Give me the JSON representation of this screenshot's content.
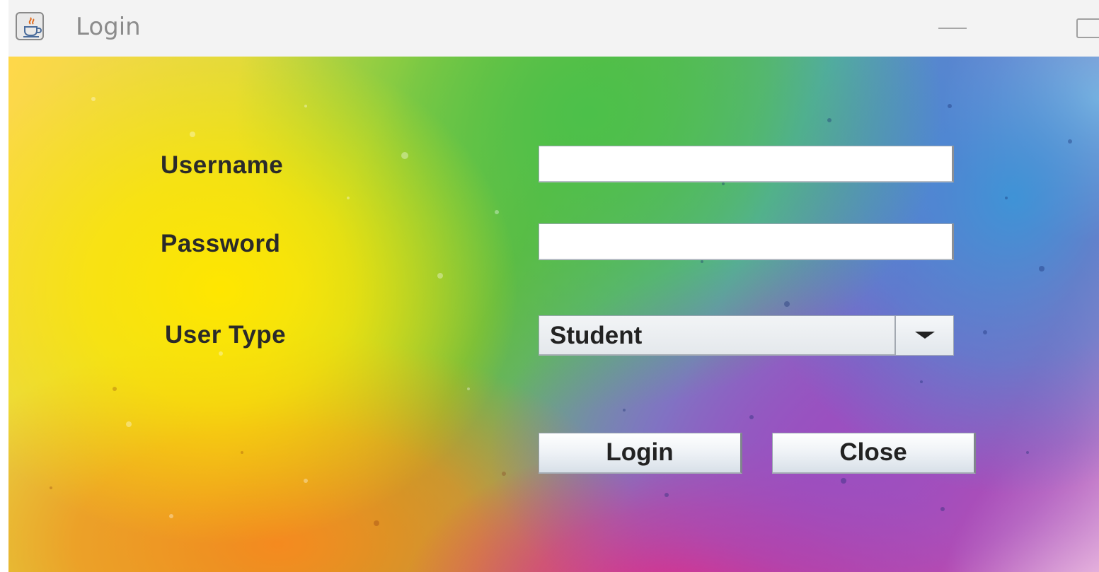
{
  "window": {
    "title": "Login",
    "icon": "java-cup-icon",
    "controls": {
      "minimize": "minimize-icon",
      "maximize": "maximize-icon"
    }
  },
  "form": {
    "username_label": "Username",
    "username_value": "",
    "password_label": "Password",
    "password_value": "",
    "usertype_label": "User Type",
    "usertype_selected": "Student",
    "login_button": "Login",
    "close_button": "Close"
  },
  "colors": {
    "background": [
      "#ffe600",
      "#4cc04a",
      "#3f93d6",
      "#9c4fc0",
      "#f0257a",
      "#f58a1f"
    ],
    "label_text": "#2a2a2a",
    "titlebar": "#f3f3f3"
  }
}
